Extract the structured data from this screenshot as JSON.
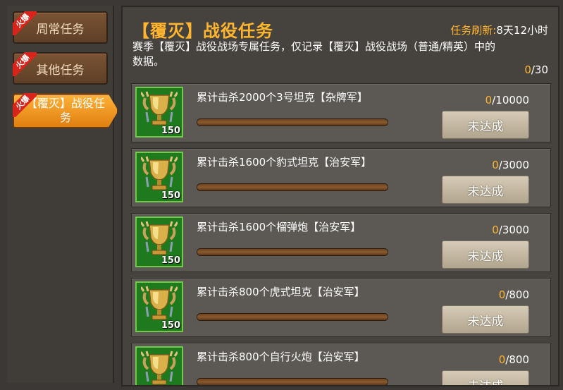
{
  "sidebar": {
    "tabs": [
      {
        "label": "周常任务",
        "hot": "火爆"
      },
      {
        "label": "其他任务",
        "hot": "火爆"
      },
      {
        "label": "【覆灭】战役任务",
        "hot": "火爆"
      }
    ]
  },
  "header": {
    "title": "【覆灭】战役任务",
    "refresh_label": "任务刷新:",
    "refresh_value": "8天12小时",
    "description": "赛季【覆灭】战役战场专属任务，仅记录【覆灭】战役战场（普通/精英）中的数据。",
    "total_current": "0",
    "total_max": "/30"
  },
  "tasks": [
    {
      "name": "累计击杀2000个3号坦克【杂牌军】",
      "current": "0",
      "target": "/10000",
      "progress": 0,
      "reward": "150",
      "button": "未达成"
    },
    {
      "name": "累计击杀1600个豹式坦克【治安军】",
      "current": "0",
      "target": "/3000",
      "progress": 0,
      "reward": "150",
      "button": "未达成"
    },
    {
      "name": "累计击杀1600个榴弹炮【治安军】",
      "current": "0",
      "target": "/3000",
      "progress": 0,
      "reward": "150",
      "button": "未达成"
    },
    {
      "name": "累计击杀800个虎式坦克【治安军】",
      "current": "0",
      "target": "/800",
      "progress": 0,
      "reward": "150",
      "button": "未达成"
    },
    {
      "name": "累计击杀800个自行火炮【治安军】",
      "current": "0",
      "target": "/800",
      "progress": 0,
      "reward": "150",
      "button": "未达成"
    }
  ],
  "colors": {
    "accent": "#ffb52e",
    "icon_bg": "#1f7a1e",
    "hot": "#d8241b"
  },
  "icons": {
    "reward": "trophy-icon"
  }
}
